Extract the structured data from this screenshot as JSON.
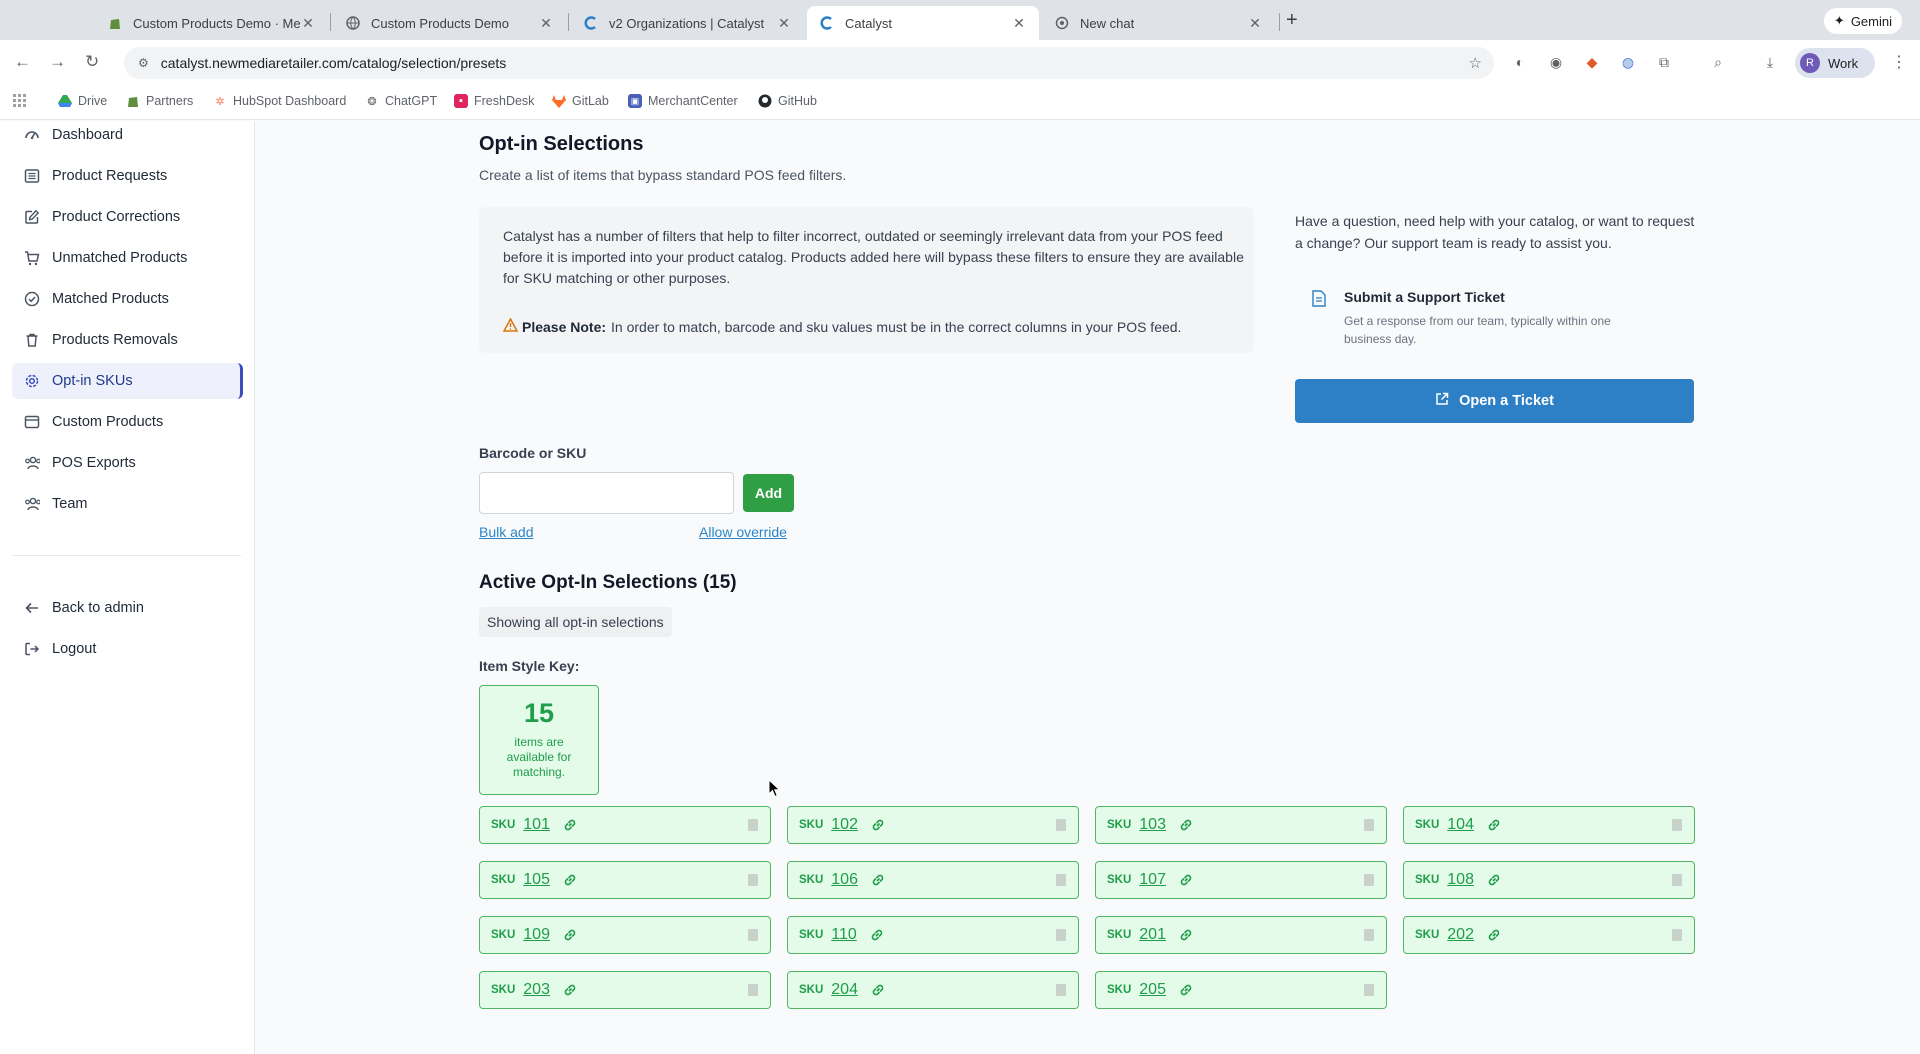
{
  "browser": {
    "tabs": [
      {
        "title": "Custom Products Demo · Me",
        "icon": "shopify-icon"
      },
      {
        "title": "Custom Products Demo",
        "icon": "globe-icon"
      },
      {
        "title": "v2 Organizations | Catalyst",
        "icon": "catalyst-icon"
      },
      {
        "title": "Catalyst",
        "icon": "catalyst-icon"
      },
      {
        "title": "New chat",
        "icon": "chat-icon"
      }
    ],
    "gemini_label": "Gemini",
    "url": "catalyst.newmediaretailer.com/catalog/selection/presets",
    "profile_initial": "R",
    "profile_label": "Work",
    "bookmarks": [
      "Drive",
      "Partners",
      "HubSpot Dashboard",
      "ChatGPT",
      "FreshDesk",
      "GitLab",
      "MerchantCenter",
      "GitHub"
    ]
  },
  "sidebar": {
    "items": [
      {
        "label": "Dashboard",
        "icon": "dashboard-icon"
      },
      {
        "label": "Product Requests",
        "icon": "list-icon"
      },
      {
        "label": "Product Corrections",
        "icon": "edit-icon"
      },
      {
        "label": "Unmatched Products",
        "icon": "cart-icon"
      },
      {
        "label": "Matched Products",
        "icon": "check-circle-icon"
      },
      {
        "label": "Products Removals",
        "icon": "trash-icon"
      },
      {
        "label": "Opt-in SKUs",
        "icon": "gear-icon",
        "active": true
      },
      {
        "label": "Custom Products",
        "icon": "box-icon"
      },
      {
        "label": "POS Exports",
        "icon": "users-icon"
      },
      {
        "label": "Team",
        "icon": "team-icon"
      }
    ],
    "back_label": "Back to admin",
    "logout_label": "Logout"
  },
  "main": {
    "title": "Opt-in Selections",
    "subtitle": "Create a list of items that bypass standard POS feed filters.",
    "info_text": "Catalyst has a number of filters that help to filter incorrect, outdated or seemingly irrelevant data from your POS feed before it is imported into your product catalog. Products added here will bypass these filters to ensure they are available for SKU matching or other purposes.",
    "note_label": "Please Note:",
    "note_text": "In order to match, barcode and sku values must be in the correct columns in your POS feed.",
    "help_text": "Have a question, need help with your catalog, or want to request a change? Our support team is ready to assist you.",
    "ticket_title": "Submit a Support Ticket",
    "ticket_sub": "Get a response from our team, typically within one business day.",
    "open_ticket_label": "Open a Ticket",
    "field_label": "Barcode or SKU",
    "input_value": "",
    "add_label": "Add",
    "bulk_add_label": "Bulk add",
    "allow_override_label": "Allow override",
    "active_title": "Active Opt-In Selections (15)",
    "showing_label": "Showing all opt-in selections",
    "style_key_label": "Item Style Key:",
    "key_count": "15",
    "key_text": "items are available for matching.",
    "sku_prefix": "SKU",
    "skus": [
      "101",
      "102",
      "103",
      "104",
      "105",
      "106",
      "107",
      "108",
      "109",
      "110",
      "201",
      "202",
      "203",
      "204",
      "205"
    ]
  },
  "colors": {
    "accent_blue": "#2d7fc6",
    "add_green": "#2f9e44",
    "match_green": "#1f9d4a",
    "match_bg": "#e3fbe8",
    "active_nav": "#3b4dbf"
  }
}
